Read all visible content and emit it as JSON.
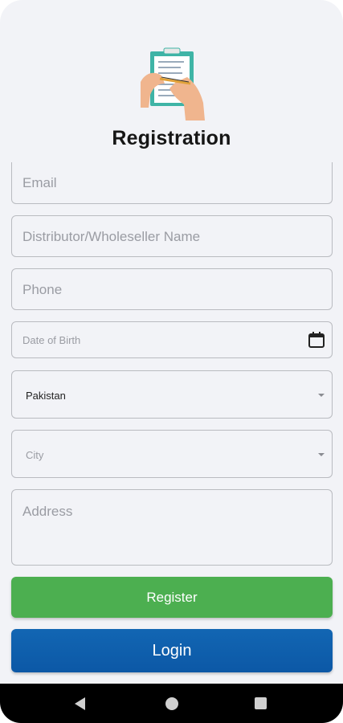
{
  "header": {
    "title": "Registration",
    "logo_icon": "clipboard-writing-icon"
  },
  "form": {
    "email_placeholder": "Email",
    "distributor_placeholder": "Distributor/Wholeseller Name",
    "phone_placeholder": "Phone",
    "dob_placeholder": "Date of Birth",
    "country_value": "Pakistan",
    "city_placeholder": "City",
    "address_placeholder": "Address"
  },
  "buttons": {
    "register_label": "Register",
    "login_label": "Login"
  },
  "colors": {
    "register": "#4caf50",
    "login": "#0f5fad",
    "background": "#f2f3f7"
  },
  "navbar": {
    "back_icon": "back-triangle-icon",
    "home_icon": "home-circle-icon",
    "recent_icon": "recent-square-icon"
  }
}
